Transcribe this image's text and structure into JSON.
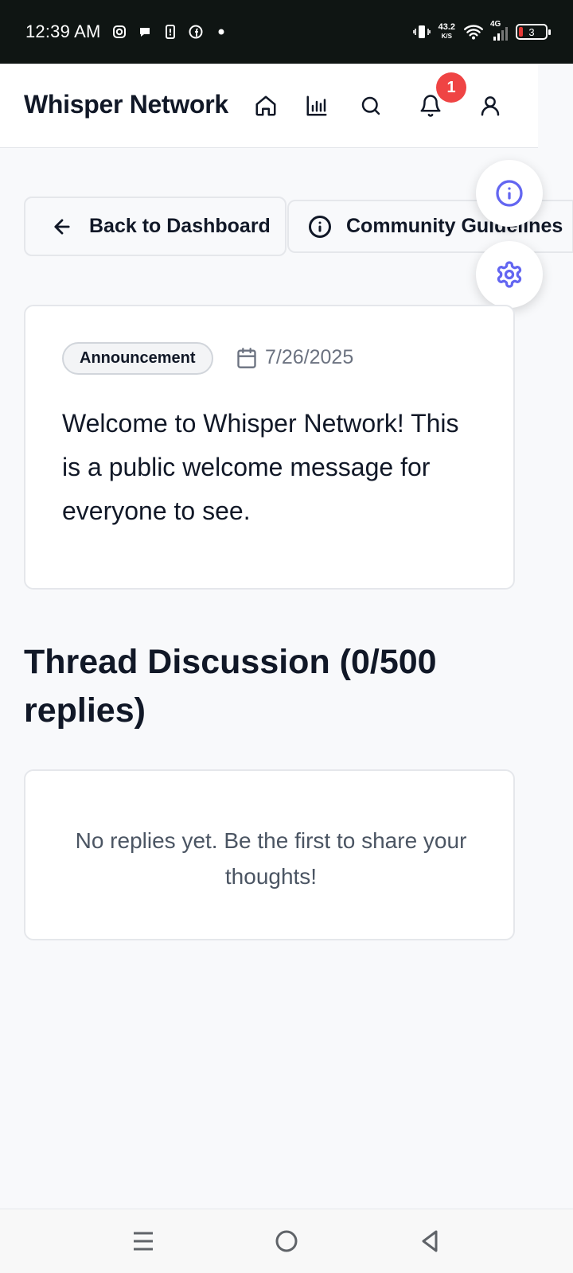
{
  "status_bar": {
    "time": "12:39 AM",
    "network_speed": "43.2",
    "network_speed_unit": "K/S",
    "network_type": "4G",
    "battery_level": "3"
  },
  "header": {
    "brand": "Whisper Network",
    "notification_count": "1",
    "icons": [
      "home-icon",
      "stats-icon",
      "search-icon",
      "bell-icon",
      "user-icon"
    ]
  },
  "actions": {
    "back_label": "Back to Dashboard",
    "guidelines_label": "Community Guidelines"
  },
  "post": {
    "tag": "Announcement",
    "date": "7/26/2025",
    "body": "Welcome to Whisper Network! This is a public welcome message for everyone to see."
  },
  "thread": {
    "title": "Thread Discussion (0/500 replies)",
    "empty_message": "No replies yet. Be the first to share your thoughts!"
  },
  "colors": {
    "accent": "#6366f1",
    "badge": "#ef4444",
    "background": "#f8f9fb"
  }
}
